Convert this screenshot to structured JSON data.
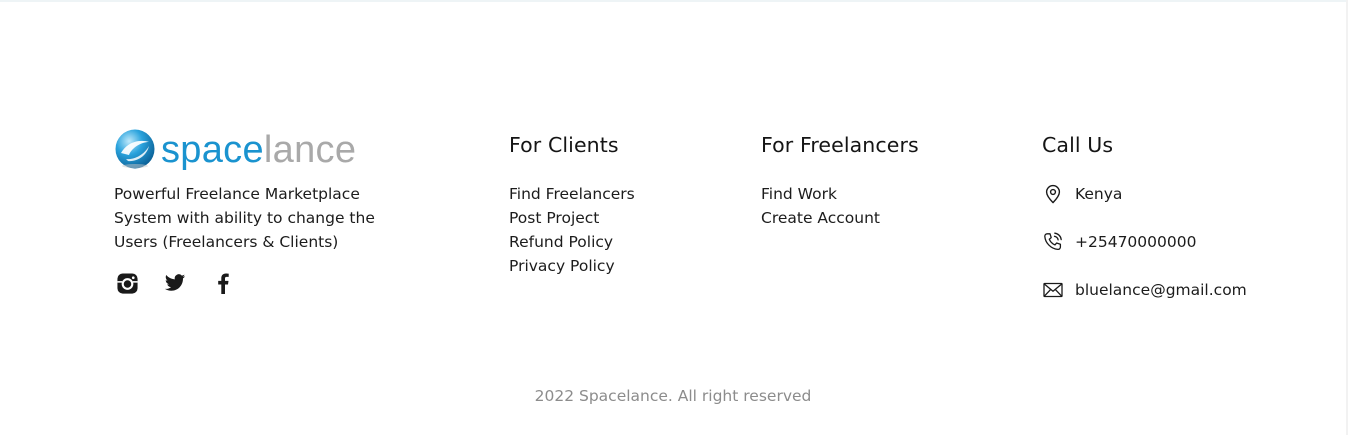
{
  "brand": {
    "logo_part1": "space",
    "logo_part2": "lance",
    "description": "Powerful Freelance Marketplace System with ability to change the Users (Freelancers & Clients)",
    "socials": [
      {
        "icon": "instagram-icon"
      },
      {
        "icon": "twitter-icon"
      },
      {
        "icon": "facebook-icon"
      }
    ]
  },
  "clients": {
    "title": "For Clients",
    "links": [
      "Find Freelancers",
      "Post Project",
      "Refund Policy",
      "Privacy Policy"
    ]
  },
  "freelancers": {
    "title": "For Freelancers",
    "links": [
      "Find Work",
      "Create Account"
    ]
  },
  "contact": {
    "title": "Call Us",
    "items": [
      {
        "icon": "location-pin-icon",
        "text": "Kenya"
      },
      {
        "icon": "phone-icon",
        "text": "+25470000000"
      },
      {
        "icon": "mail-icon",
        "text": "bluelance@gmail.com"
      }
    ]
  },
  "footer": {
    "copyright": "2022 Spacelance. All right reserved"
  },
  "colors": {
    "brand_blue": "#1a93cf",
    "brand_gray": "#a9a9a9",
    "muted_text": "#8c8c8c"
  }
}
